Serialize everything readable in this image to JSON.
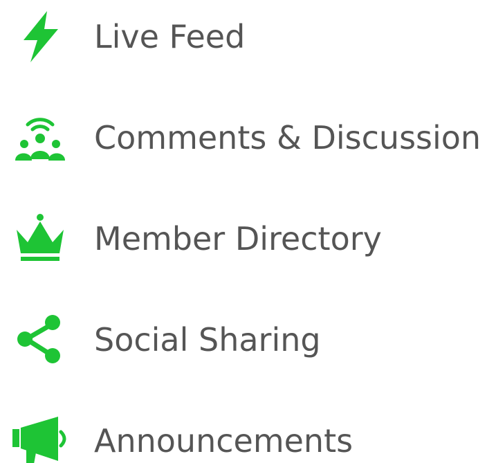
{
  "accent_color": "#1ec435",
  "text_color": "#555555",
  "features": [
    {
      "icon": "lightning-bolt-icon",
      "label": "Live Feed"
    },
    {
      "icon": "group-broadcast-icon",
      "label": "Comments & Discussion"
    },
    {
      "icon": "crown-icon",
      "label": "Member Directory"
    },
    {
      "icon": "share-icon",
      "label": "Social Sharing"
    },
    {
      "icon": "megaphone-icon",
      "label": "Announcements"
    }
  ]
}
